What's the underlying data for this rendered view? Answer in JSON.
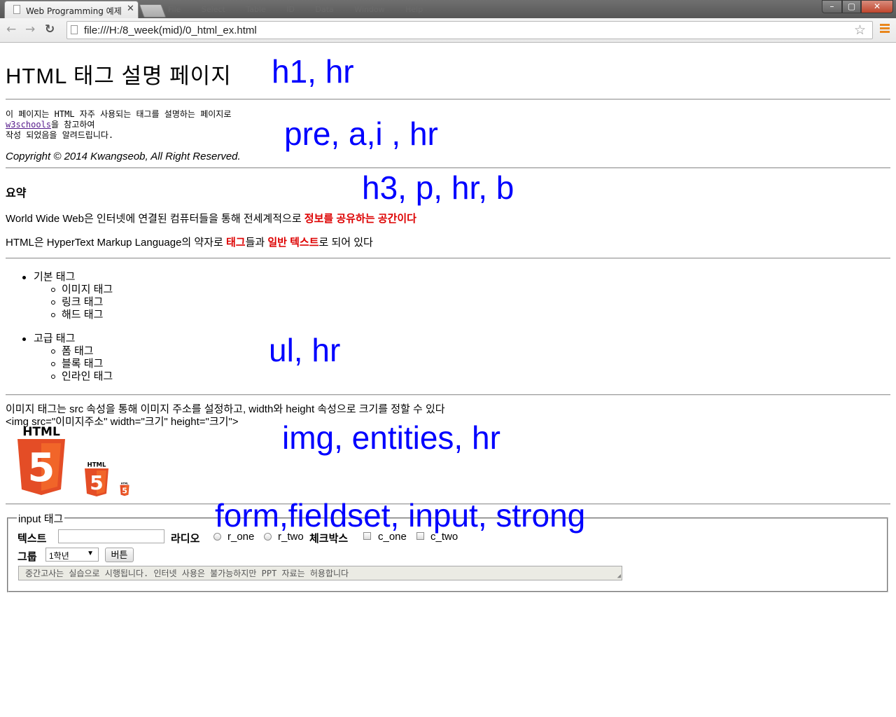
{
  "browser": {
    "tab_title": "Web Programming 예제",
    "tab_close": "✕",
    "ghost_menu": "File Select Table ID Data Window Help",
    "url": "file:///H:/8_week(mid)/0_html_ex.html",
    "win_min": "–",
    "win_max": "▢",
    "win_close": "✕",
    "back": "←",
    "forward": "→",
    "reload": "↻",
    "star": "☆"
  },
  "page": {
    "h1": "HTML 태그 설명 페이지",
    "pre_line1": "이 페이지는 HTML 자주 사용되는 태그를 설명하는 페이지로",
    "pre_link": "w3schools",
    "pre_line2_rest": "을 참고하여",
    "pre_line3": "작성 되었음을 알려드립니다.",
    "copyright": "Copyright © 2014 Kwangseob, All Right Reserved.",
    "h3": "요약",
    "p1_plain": "World Wide Web은 인터넷에 연결된 컴퓨터들을 통해 전세계적으로 ",
    "p1_bold": "정보를 공유하는 공간이다",
    "p2_a": "HTML은 HyperText Markup Language의 약자로 ",
    "p2_b": "태그",
    "p2_c": "들과 ",
    "p2_d": "일반 텍스트",
    "p2_e": "로 되어 있다",
    "list": {
      "basic": "기본 태그",
      "basic_items": [
        "이미지 태그",
        "링크 태그",
        "해드 태그"
      ],
      "advanced": "고급 태그",
      "advanced_items": [
        "폼 태그",
        "블록 태그",
        "인라인 태그"
      ]
    },
    "img_desc": "이미지 태그는 src 속성을 통해 이미지 주소를 설정하고, width와 height 속성으로 크기를 정할 수 있다",
    "img_code": "<img src=\"이미지주소\" width=\"크기\" height=\"크기\">",
    "logo_text": "HTML",
    "logo_num": "5",
    "form": {
      "legend": "input 태그",
      "text_label": "텍스트",
      "radio_label": "라디오",
      "r_one": "r_one",
      "r_two": "r_two",
      "check_label": "체크박스",
      "c_one": "c_one",
      "c_two": "c_two",
      "group_label": "그룹",
      "select_value": "1학년",
      "select_arrow": "▼",
      "button_label": "버튼",
      "textarea_value": "중간고사는 실습으로 시행됩니다. 인터넷 사용은 불가능하지만 PPT 자료는 허용합니다"
    }
  },
  "annotations": {
    "a1": "h1, hr",
    "a2": "pre,  a,i , hr",
    "a3": "h3, p, hr, b",
    "a4": "ul, hr",
    "a5": "img, entities, hr",
    "a6": "form,fieldset, input, strong"
  },
  "colors": {
    "annotation": "#0000ff",
    "emphasis": "#dd0000",
    "logo_orange": "#e44d26",
    "logo_light": "#f16529"
  }
}
